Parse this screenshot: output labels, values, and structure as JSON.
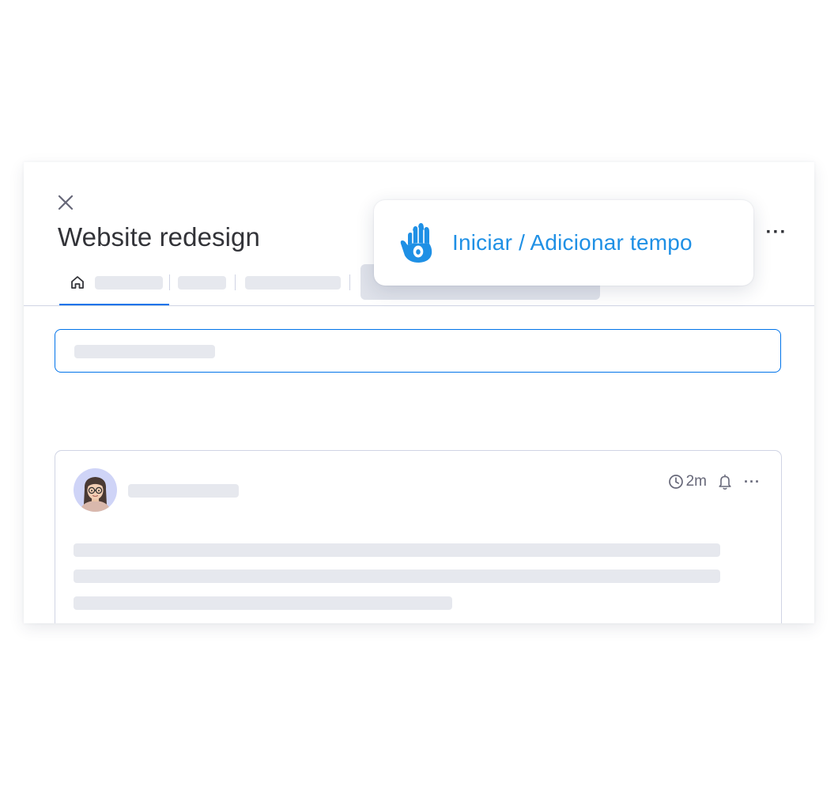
{
  "panel": {
    "title": "Website redesign"
  },
  "header": {
    "more_label": "···"
  },
  "card": {
    "time": "2m",
    "more_label": "···"
  },
  "popup": {
    "label": "Iniciar / Adicionar tempo"
  },
  "icons": {
    "close": "close-icon",
    "home": "home-icon",
    "clock": "clock-icon",
    "bell": "bell-icon",
    "hand": "hand-icon"
  },
  "colors": {
    "accent": "#0073ea",
    "popup_text": "#1f90e5",
    "title_text": "#323338",
    "placeholder": "#e6e8ee",
    "border": "#d0d4e4"
  }
}
